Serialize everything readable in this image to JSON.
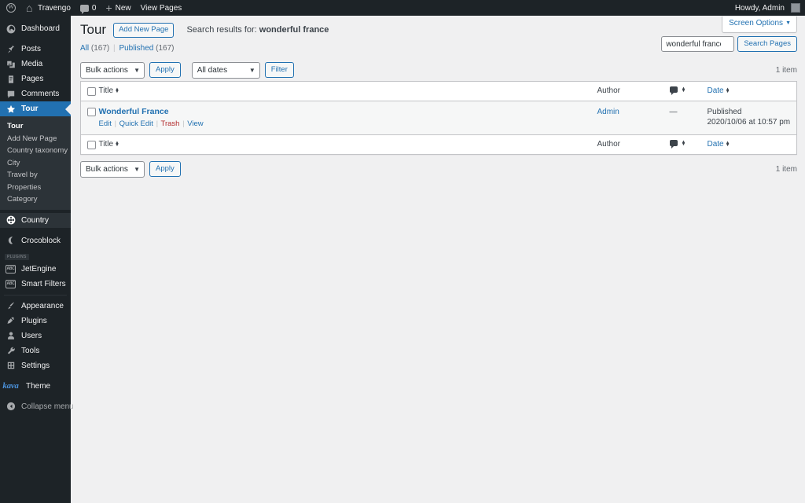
{
  "adminbar": {
    "wp_logo_name": "wordpress-logo-icon",
    "site_name": "Travengo",
    "comment_count": "0",
    "new_label": "New",
    "view_pages_label": "View Pages",
    "howdy": "Howdy, Admin"
  },
  "sidebar": {
    "items": [
      {
        "label": "Dashboard",
        "icon": "dashboard-icon",
        "state": "normal"
      },
      {
        "label": "Posts",
        "icon": "pin-icon",
        "state": "normal"
      },
      {
        "label": "Media",
        "icon": "media-icon",
        "state": "normal"
      },
      {
        "label": "Pages",
        "icon": "page-icon",
        "state": "normal"
      },
      {
        "label": "Comments",
        "icon": "comment-icon",
        "state": "normal"
      },
      {
        "label": "Tour",
        "icon": "star-icon",
        "state": "current"
      }
    ],
    "submenu": [
      {
        "label": "Tour",
        "current": true
      },
      {
        "label": "Add New Page",
        "current": false
      },
      {
        "label": "Country taxonomy",
        "current": false
      },
      {
        "label": "City",
        "current": false
      },
      {
        "label": "Travel by",
        "current": false
      },
      {
        "label": "Properties",
        "current": false
      },
      {
        "label": "Category",
        "current": false
      }
    ],
    "items2": [
      {
        "label": "Country",
        "icon": "globe-icon",
        "state": "opened"
      },
      {
        "label": "Crocoblock",
        "icon": "moon-icon",
        "state": "normal"
      }
    ],
    "plugins_badge": "Plugins",
    "plugin_items": [
      {
        "label": "JetEngine",
        "icon": "jetengine-icon",
        "badge": "ABC"
      },
      {
        "label": "Smart Filters",
        "icon": "smartfilters-icon",
        "badge": "ABC"
      }
    ],
    "items3": [
      {
        "label": "Appearance",
        "icon": "brush-icon"
      },
      {
        "label": "Plugins",
        "icon": "plugin-icon"
      },
      {
        "label": "Users",
        "icon": "user-icon"
      },
      {
        "label": "Tools",
        "icon": "wrench-icon"
      },
      {
        "label": "Settings",
        "icon": "settings-icon"
      }
    ],
    "theme": {
      "logo": "kava",
      "label": "Theme"
    },
    "collapse_label": "Collapse menu"
  },
  "screen_options": {
    "label": "Screen Options",
    "caret": "▼"
  },
  "page": {
    "title": "Tour",
    "add_new_label": "Add New Page",
    "search_results_prefix": "Search results for:",
    "search_results_term": "wonderful france"
  },
  "views": {
    "all_label": "All",
    "all_count": "(167)",
    "separator": "|",
    "published_label": "Published",
    "published_count": "(167)"
  },
  "search": {
    "value": "wonderful france",
    "placeholder": "",
    "button_label": "Search Pages"
  },
  "tablenav_top": {
    "bulk_select": "Bulk actions",
    "apply_label": "Apply",
    "date_select": "All dates",
    "filter_label": "Filter",
    "displaying_num": "1 item"
  },
  "tablenav_bottom": {
    "bulk_select": "Bulk actions",
    "apply_label": "Apply",
    "displaying_num": "1 item"
  },
  "table": {
    "columns": {
      "title": "Title",
      "author": "Author",
      "comments": "comment-bubble-icon",
      "date": "Date"
    },
    "rows": [
      {
        "title": "Wonderful France",
        "actions": {
          "edit": "Edit",
          "quick_edit": "Quick Edit",
          "trash": "Trash",
          "view": "View",
          "sep": "|"
        },
        "author": "Admin",
        "comments": "—",
        "date_status": "Published",
        "date_value": "2020/10/06 at 10:57 pm"
      }
    ]
  },
  "colors": {
    "admin_bg": "#1d2327",
    "submenu_bg": "#2c3338",
    "accent": "#2271b1",
    "trash": "#b32d2e",
    "body_bg": "#f0f0f1",
    "row_bg": "#f6f7f7"
  }
}
